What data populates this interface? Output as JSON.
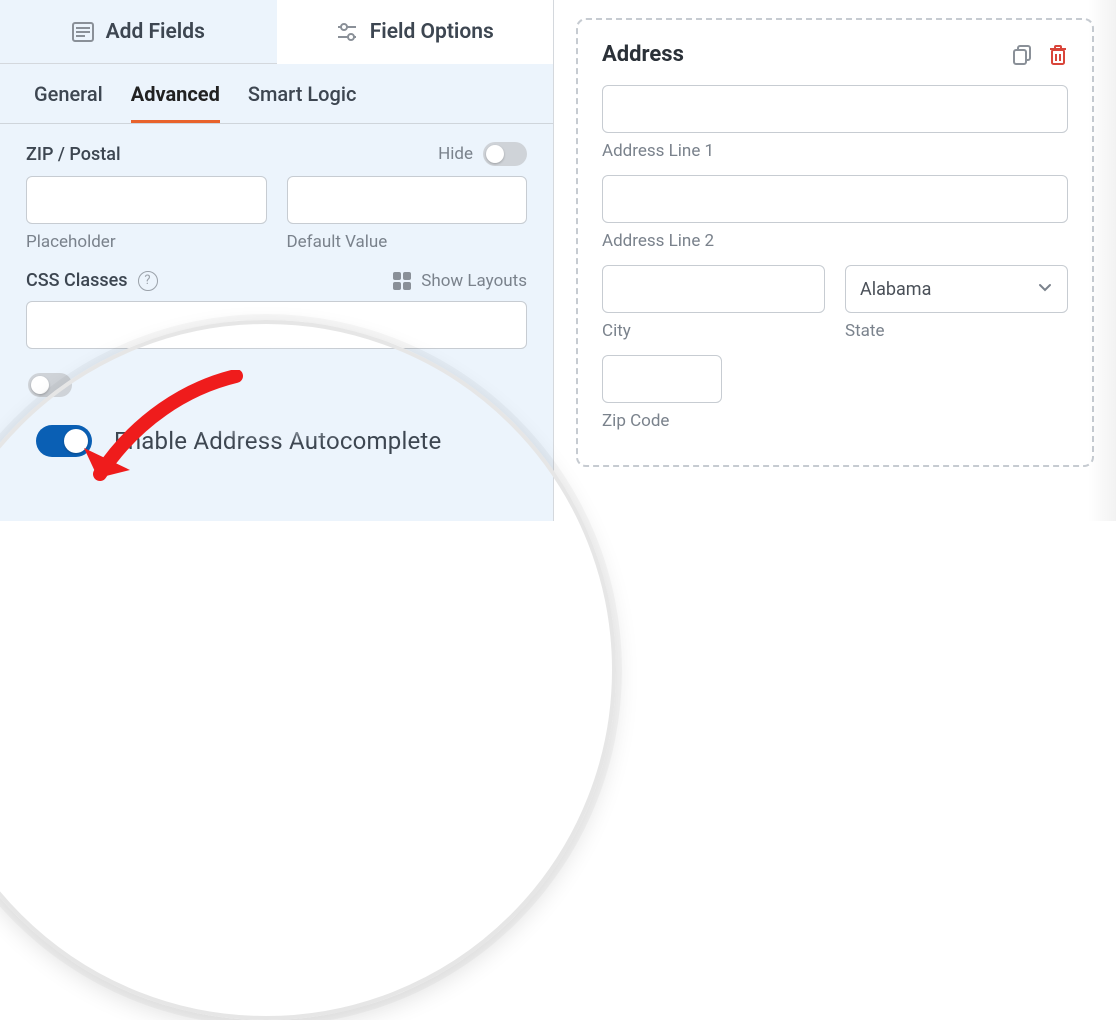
{
  "top_tabs": {
    "add_fields": "Add Fields",
    "field_options": "Field Options"
  },
  "sub_tabs": {
    "general": "General",
    "advanced": "Advanced",
    "smart_logic": "Smart Logic"
  },
  "zip_section": {
    "label": "ZIP / Postal",
    "hide": "Hide",
    "placeholder_label": "Placeholder",
    "default_label": "Default Value"
  },
  "css_section": {
    "label": "CSS Classes",
    "show_layouts": "Show Layouts"
  },
  "enable_row": {
    "label": "Enable Address Autocomplete"
  },
  "preview": {
    "title": "Address",
    "line1": "Address Line 1",
    "line2": "Address Line 2",
    "city": "City",
    "state": "State",
    "state_value": "Alabama",
    "zip": "Zip Code"
  }
}
